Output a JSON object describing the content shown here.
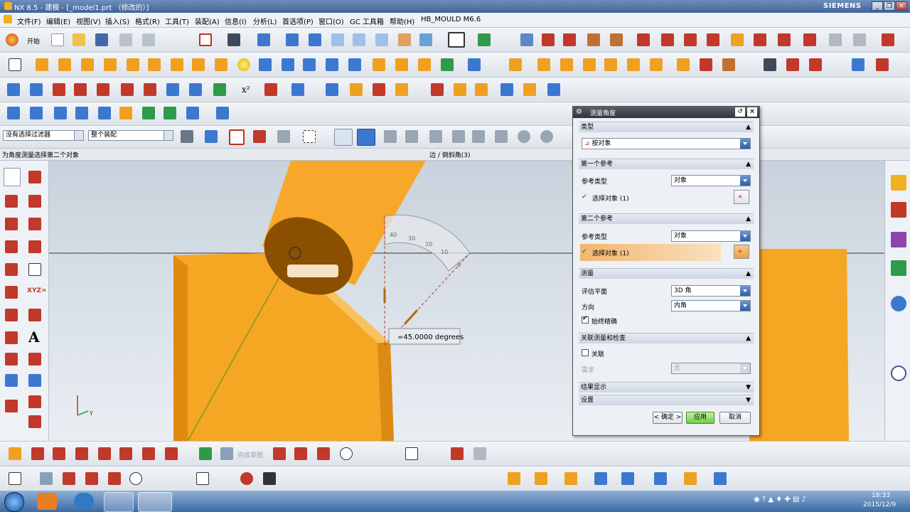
{
  "window": {
    "title": "NX 8.5 - 建模 - [_model1.prt （修改的）]",
    "brand": "SIEMENS"
  },
  "menu": [
    "文件(F)",
    "编辑(E)",
    "视图(V)",
    "插入(S)",
    "格式(R)",
    "工具(T)",
    "装配(A)",
    "信息(I)",
    "分析(L)",
    "首选项(P)",
    "窗口(O)",
    "GC 工具箱",
    "帮助(H)",
    "HB_MOULD M6.6"
  ],
  "toolbar": {
    "start_label": "开始",
    "filter_value": "没有选择过滤器",
    "scope_value": "整个装配"
  },
  "status": {
    "prompt": "为角度测量选择第二个对象",
    "selection": "边 / 倒斜角(3)"
  },
  "viewport": {
    "measure_label": "=45.0000 degrees",
    "protractor_ticks": [
      "40",
      "30",
      "20",
      "10",
      "0"
    ],
    "axis_y": "Y"
  },
  "dialog": {
    "title": "测量角度",
    "type_section": "类型",
    "type_value": "按对象",
    "ref1_section": "第一个参考",
    "ref1_type_label": "参考类型",
    "ref1_type_value": "对象",
    "ref1_select": "选择对象 (1)",
    "ref2_section": "第二个参考",
    "ref2_type_label": "参考类型",
    "ref2_type_value": "对象",
    "ref2_select": "选择对象 (1)",
    "measure_section": "测量",
    "plane_label": "评估平面",
    "plane_value": "3D 角",
    "dir_label": "方向",
    "dir_value": "内角",
    "accurate_label": "始终精确",
    "assoc_section": "关联测量和检查",
    "assoc_label": "关联",
    "req_label": "需求",
    "req_value": "无",
    "result_section": "结果显示",
    "settings_section": "设置",
    "ok": "< 确定 >",
    "apply": "应用",
    "cancel": "取消"
  },
  "bottom": {
    "complete_sketch": "完成草图"
  },
  "taskbar": {
    "time": "18:33",
    "date": "2015/12/9"
  }
}
